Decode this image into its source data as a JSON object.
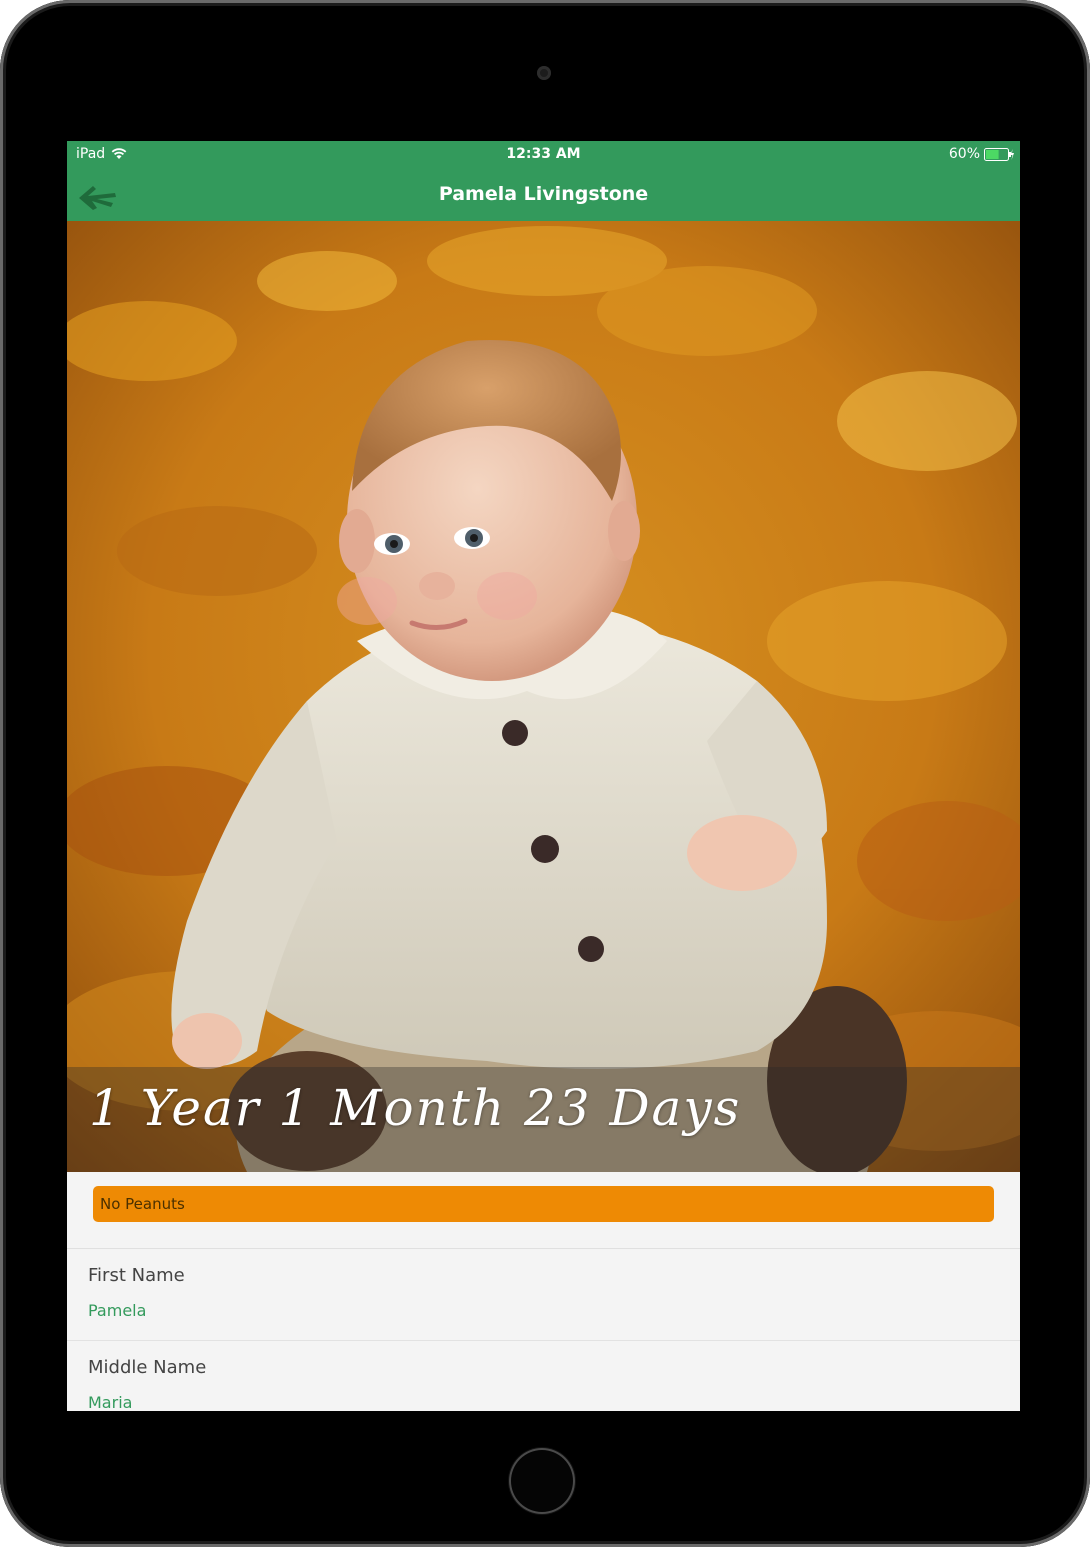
{
  "status_bar": {
    "device": "iPad",
    "time": "12:33 AM",
    "battery": "60%",
    "battery_level": 0.6
  },
  "nav": {
    "title": "Pamela Livingstone",
    "back_icon": "arrow-left-icon"
  },
  "hero": {
    "age_text": "1 Year 1 Month 23 Days"
  },
  "allergy": {
    "label": "No Peanuts",
    "color": "#ee8a04"
  },
  "fields": [
    {
      "label": "First Name",
      "value": "Pamela"
    },
    {
      "label": "Middle Name",
      "value": "Maria"
    }
  ],
  "colors": {
    "brand": "#339a5c",
    "field_value": "#339a5c"
  }
}
